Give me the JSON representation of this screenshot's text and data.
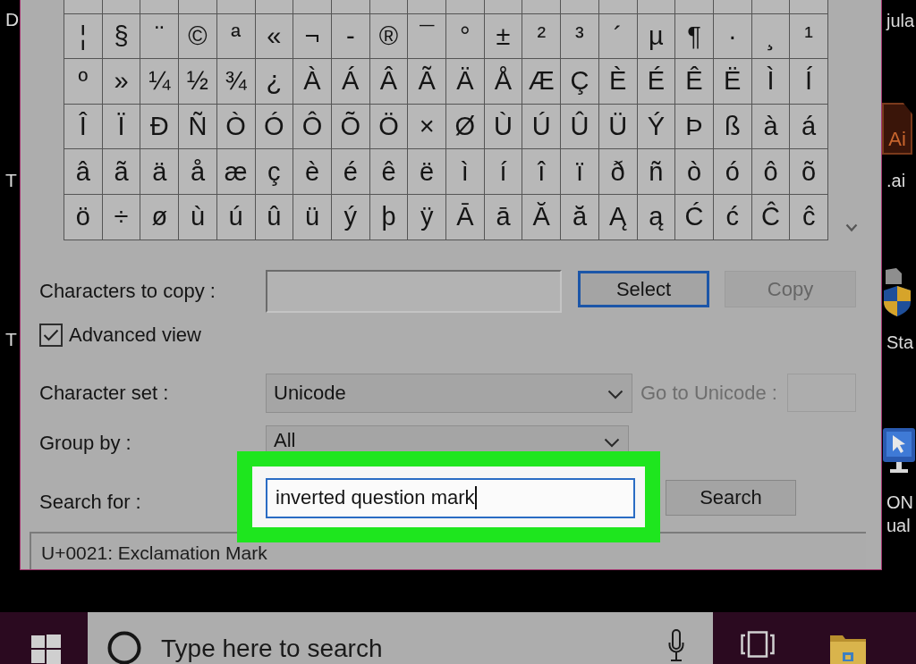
{
  "desktop": {
    "left_labels": [
      "D",
      "T",
      "T"
    ],
    "right_icons": [
      {
        "kind": "label",
        "lines": [
          "jula"
        ]
      },
      {
        "kind": "ai-file",
        "badge": "Ai",
        "lines": [
          ".ai"
        ]
      },
      {
        "kind": "shield",
        "lines": [
          "Sta"
        ]
      },
      {
        "kind": "monitor",
        "lines": [
          "ON",
          "ual"
        ]
      }
    ]
  },
  "character_map": {
    "grid": {
      "rows": [
        [
          "¦",
          "§",
          "¨",
          "©",
          "ª",
          "«",
          "¬",
          "-",
          "®",
          "¯",
          "°",
          "±",
          "²",
          "³",
          "´",
          "µ",
          "¶",
          "·",
          "¸",
          "¹"
        ],
        [
          "º",
          "»",
          "¼",
          "½",
          "¾",
          "¿",
          "À",
          "Á",
          "Â",
          "Ã",
          "Ä",
          "Å",
          "Æ",
          "Ç",
          "È",
          "É",
          "Ê",
          "Ë",
          "Ì",
          "Í"
        ],
        [
          "Î",
          "Ï",
          "Ð",
          "Ñ",
          "Ò",
          "Ó",
          "Ô",
          "Õ",
          "Ö",
          "×",
          "Ø",
          "Ù",
          "Ú",
          "Û",
          "Ü",
          "Ý",
          "Þ",
          "ß",
          "à",
          "á"
        ],
        [
          "â",
          "ã",
          "ä",
          "å",
          "æ",
          "ç",
          "è",
          "é",
          "ê",
          "ë",
          "ì",
          "í",
          "î",
          "ï",
          "ð",
          "ñ",
          "ò",
          "ó",
          "ô",
          "õ"
        ],
        [
          "ö",
          "÷",
          "ø",
          "ù",
          "ú",
          "û",
          "ü",
          "ý",
          "þ",
          "ÿ",
          "Ā",
          "ā",
          "Ă",
          "ă",
          "Ą",
          "ą",
          "Ć",
          "ć",
          "Ĉ",
          "ĉ"
        ]
      ]
    },
    "characters_to_copy": {
      "label": "Characters to copy :"
    },
    "select_button": {
      "label": "Select",
      "default": true
    },
    "copy_button": {
      "label": "Copy",
      "disabled": true
    },
    "advanced_view": {
      "label": "Advanced view",
      "checked": true
    },
    "character_set": {
      "label": "Character set :",
      "value": "Unicode"
    },
    "go_to_unicode": {
      "label": "Go to Unicode :",
      "disabled": true
    },
    "group_by": {
      "label": "Group by :",
      "value": "All"
    },
    "search_for": {
      "label": "Search for :",
      "value": "inverted question mark",
      "focused": true,
      "highlighted": true
    },
    "search_button": {
      "label": "Search"
    },
    "status": "U+0021: Exclamation Mark"
  },
  "taskbar": {
    "search_placeholder": "Type here to search"
  }
}
